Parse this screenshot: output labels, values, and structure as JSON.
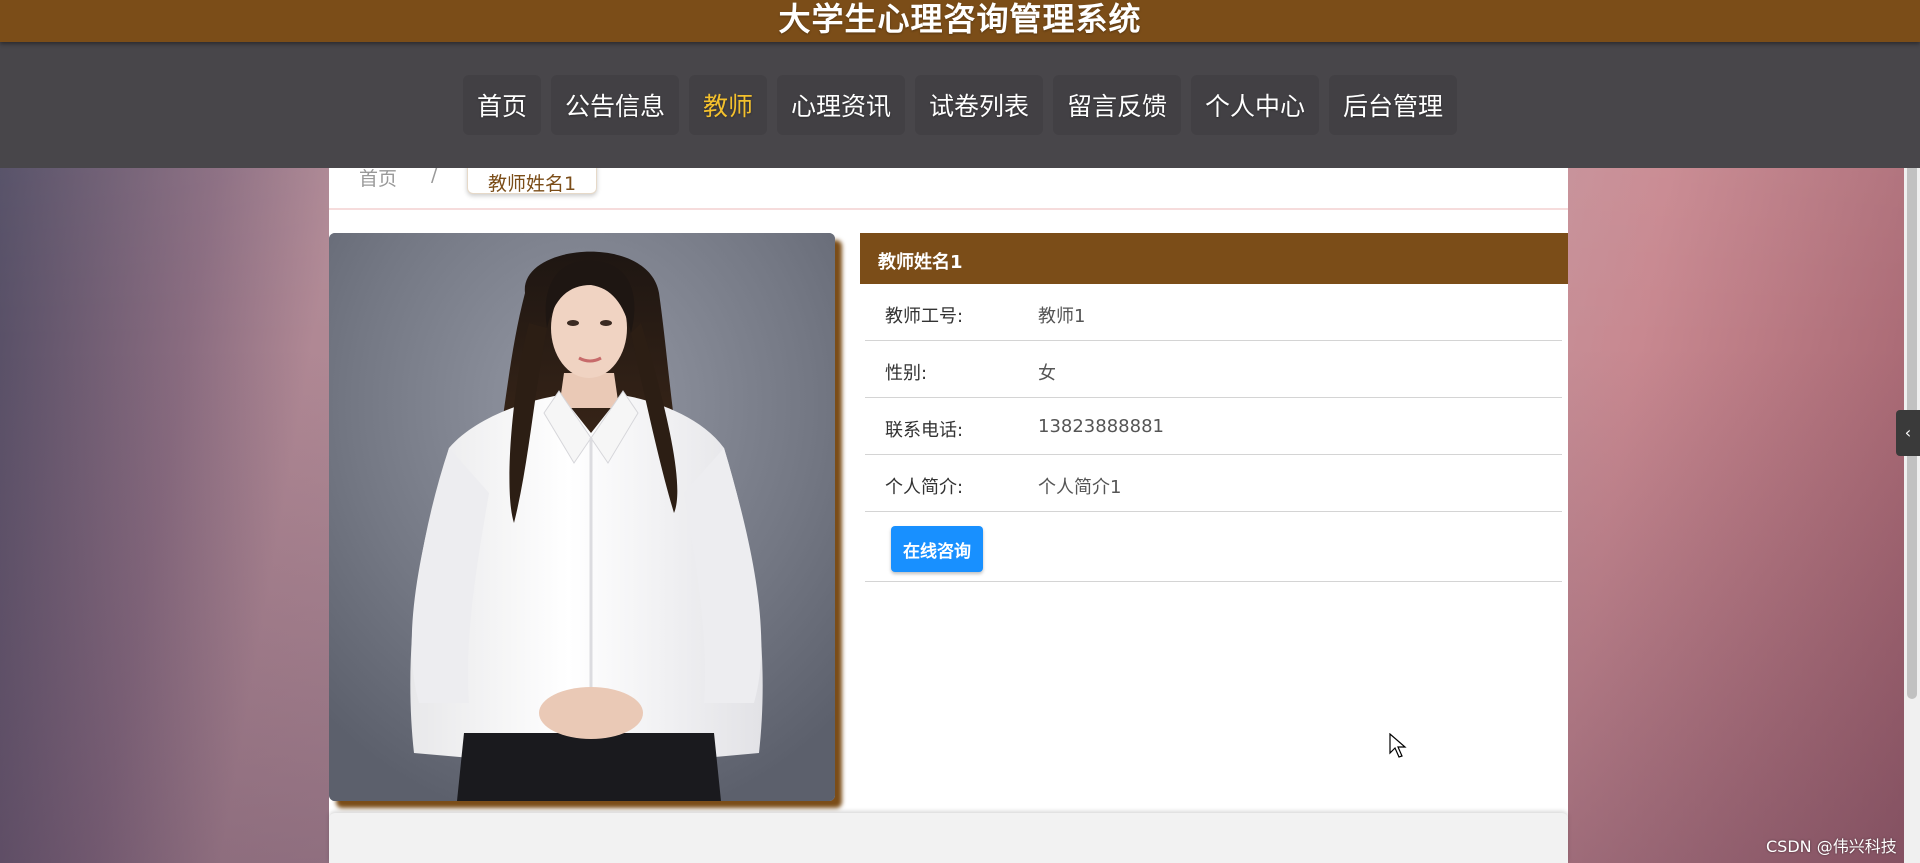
{
  "header": {
    "title": "大学生心理咨询管理系统"
  },
  "nav": {
    "items": [
      {
        "label": "首页",
        "active": false
      },
      {
        "label": "公告信息",
        "active": false
      },
      {
        "label": "教师",
        "active": true
      },
      {
        "label": "心理资讯",
        "active": false
      },
      {
        "label": "试卷列表",
        "active": false
      },
      {
        "label": "留言反馈",
        "active": false
      },
      {
        "label": "个人中心",
        "active": false
      },
      {
        "label": "后台管理",
        "active": false
      }
    ]
  },
  "breadcrumb": {
    "home": "首页",
    "separator": "/",
    "current": "教师姓名1"
  },
  "teacher": {
    "name": "教师姓名1",
    "fields": [
      {
        "label": "教师工号:",
        "value": "教师1"
      },
      {
        "label": "性别:",
        "value": "女"
      },
      {
        "label": "联系电话:",
        "value": "13823888881"
      },
      {
        "label": "个人简介:",
        "value": "个人简介1"
      }
    ],
    "consult_button": "在线咨询"
  },
  "side_toggle": {
    "glyph": "‹"
  },
  "watermark": "CSDN @伟兴科技",
  "colors": {
    "brand": "#7b4d18",
    "nav_bg": "#48464a",
    "nav_active": "#f3c02d",
    "button": "#1890ff"
  }
}
